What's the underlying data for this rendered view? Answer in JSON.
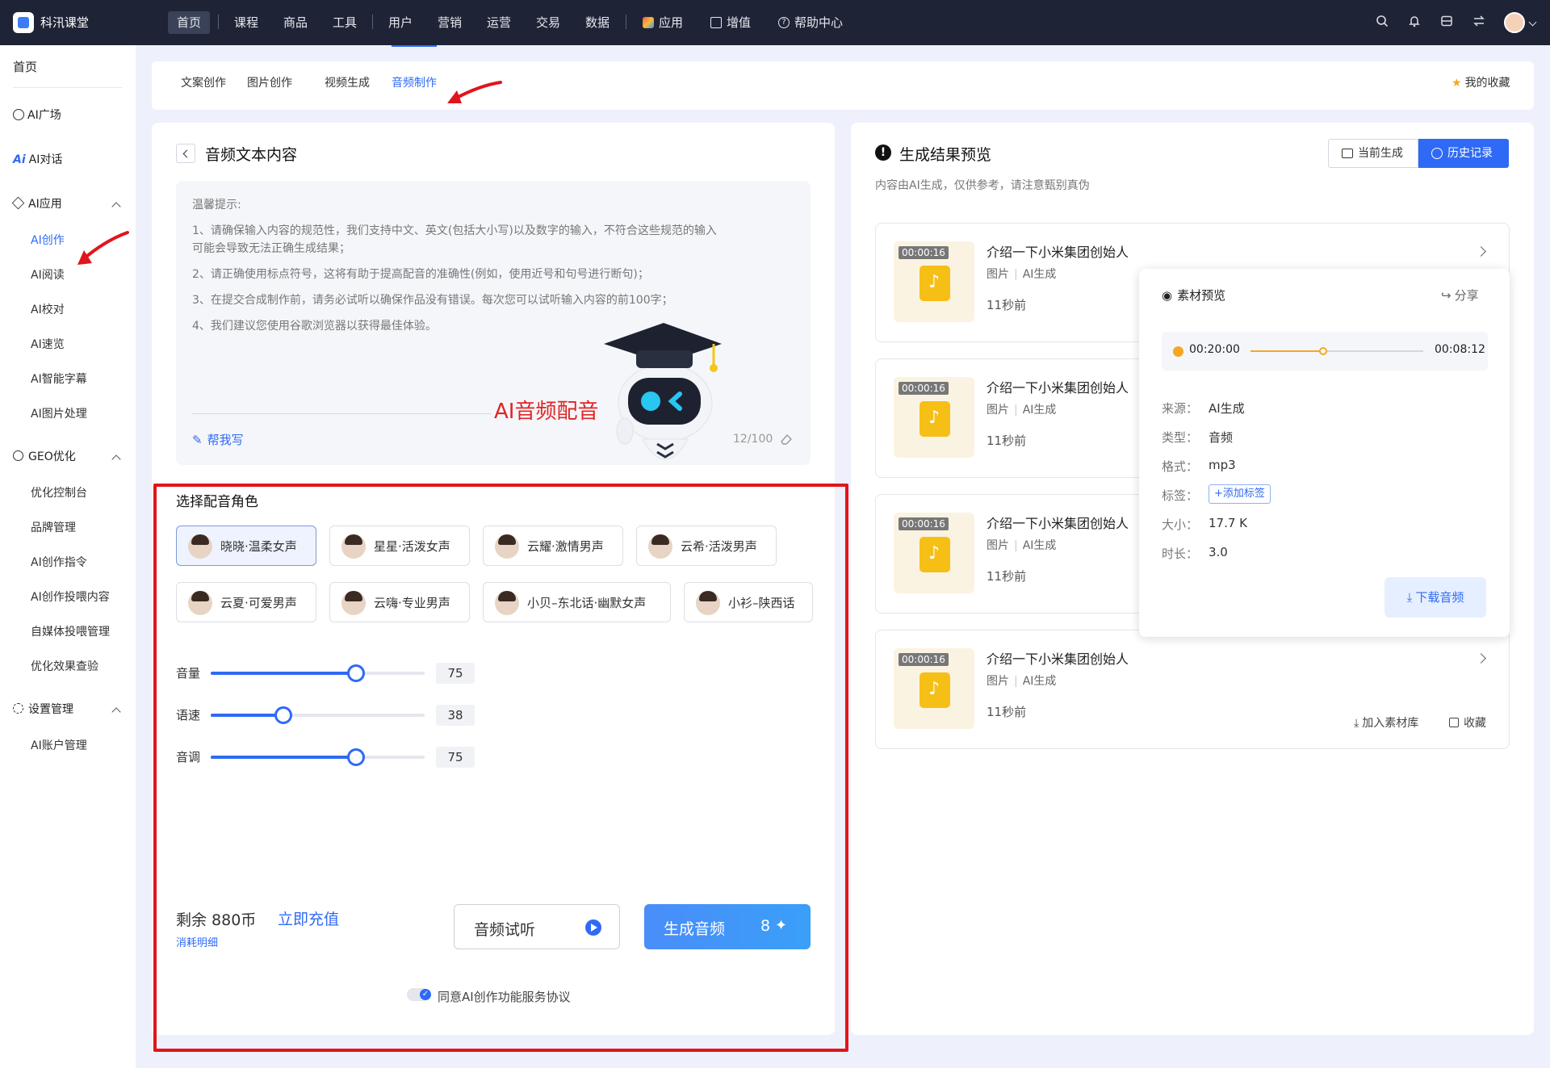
{
  "app": {
    "title": "科汛课堂"
  },
  "topnav": {
    "items": [
      "首页",
      "课程",
      "商品",
      "工具",
      "用户",
      "营销",
      "运营",
      "交易",
      "数据",
      "应用",
      "增值",
      "帮助中心"
    ],
    "active_index": 0
  },
  "sidebar": {
    "home": "首页",
    "ai_square": "AI广场",
    "ai_chat": "AI对话",
    "ai_apps": {
      "label": "AI应用",
      "items": [
        "AI创作",
        "AI阅读",
        "AI校对",
        "AI速览",
        "AI智能字幕",
        "AI图片处理"
      ],
      "active_index": 0
    },
    "geo": {
      "label": "GEO优化",
      "items": [
        "优化控制台",
        "品牌管理",
        "AI创作指令",
        "AI创作投喂内容",
        "自媒体投喂管理",
        "优化效果查验"
      ]
    },
    "settings": {
      "label": "设置管理",
      "items": [
        "AI账户管理"
      ]
    }
  },
  "tabs": {
    "items": [
      "文案创作",
      "图片创作",
      "视频生成",
      "音频制作"
    ],
    "active_index": 3,
    "favorites": "我的收藏"
  },
  "left": {
    "title": "音频文本内容",
    "notice_title": "温馨提示:",
    "notice_lines": [
      "1、请确保输入内容的规范性，我们支持中文、英文(包括大小写)以及数字的输入，不符合这些规范的输入",
      "可能会导致无法正确生成结果；",
      "2、请正确使用标点符号，这将有助于提高配音的准确性(例如，使用近号和句号进行断句)；",
      "3、在提交合成制作前，请务必试听以确保作品没有错误。每次您可以试听输入内容的前100字；",
      "4、我们建议您使用谷歌浏览器以获得最佳体验。"
    ],
    "robot_caption": "AI音频配音",
    "help_write": "帮我写",
    "char_count": "12/100",
    "voice_title": "选择配音角色",
    "voices": [
      "晓晓·温柔女声",
      "星星·活泼女声",
      "云耀·激情男声",
      "云希·活泼男声",
      "云夏·可爱男声",
      "云嗨·专业男声",
      "小贝–东北话·幽默女声",
      "小衫–陕西话"
    ],
    "selected_voice": 0,
    "sliders": [
      {
        "label": "音量",
        "value": "75",
        "fraction": 0.68
      },
      {
        "label": "语速",
        "value": "38",
        "fraction": 0.34
      },
      {
        "label": "音调",
        "value": "75",
        "fraction": 0.68
      }
    ],
    "balance": "剩余 880币",
    "recharge": "立即充值",
    "detail": "消耗明细",
    "preview_btn": "音频试听",
    "generate_btn": "生成音频",
    "generate_cost": "8",
    "agreement": "同意AI创作功能服务协议"
  },
  "right": {
    "title": "生成结果预览",
    "subtitle": "内容由AI生成，仅供参考，请注意甄别真伪",
    "btn_current": "当前生成",
    "btn_history": "历史记录",
    "cards": [
      {
        "duration": "00:00:16",
        "title": "介绍一下小米集团创始人",
        "type": "图片",
        "source": "AI生成",
        "time": "11秒前"
      },
      {
        "duration": "00:00:16",
        "title": "介绍一下小米集团创始人",
        "type": "图片",
        "source": "AI生成",
        "time": "11秒前"
      },
      {
        "duration": "00:00:16",
        "title": "介绍一下小米集团创始人",
        "type": "图片",
        "source": "AI生成",
        "time": "11秒前"
      },
      {
        "duration": "00:00:16",
        "title": "介绍一下小米集团创始人",
        "type": "图片",
        "source": "AI生成",
        "time": "11秒前"
      }
    ],
    "add_material": "加入素材库",
    "collect": "收藏",
    "popover": {
      "title": "素材预览",
      "share": "分享",
      "time_current": "00:20:00",
      "time_total": "00:08:12",
      "progress": 0.42,
      "labels": [
        "来源：",
        "类型：",
        "格式：",
        "标签：",
        "大小：",
        "时长："
      ],
      "values": [
        "AI生成",
        "音频",
        "mp3",
        "",
        "17.7 K",
        "3.0"
      ],
      "add_tag": "+添加标签",
      "download": "下载音频"
    }
  }
}
